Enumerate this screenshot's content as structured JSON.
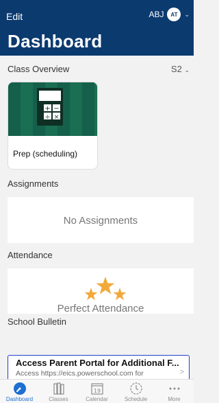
{
  "header": {
    "edit_label": "Edit",
    "user_initials": "ABJ",
    "avatar_text": "AT",
    "title": "Dashboard"
  },
  "class_overview": {
    "label": "Class Overview",
    "term": "S2",
    "classes": [
      {
        "name": "Prep (scheduling)"
      }
    ]
  },
  "assignments": {
    "label": "Assignments",
    "empty_text": "No Assignments"
  },
  "attendance": {
    "label": "Attendance",
    "status_text": "Perfect Attendance"
  },
  "bulletin": {
    "label": "School Bulletin",
    "title": "Access Parent Portal for Additional F...",
    "body": "Access https://eics.powerschool.com for additional features, such as the ability to su..."
  },
  "tabs": [
    {
      "label": "Dashboard",
      "icon": "dashboard-icon",
      "active": true
    },
    {
      "label": "Classes",
      "icon": "classes-icon",
      "active": false
    },
    {
      "label": "Calendar",
      "icon": "calendar-icon",
      "date": "19",
      "active": false
    },
    {
      "label": "Schedule",
      "icon": "schedule-icon",
      "active": false
    },
    {
      "label": "More",
      "icon": "more-icon",
      "active": false
    }
  ],
  "colors": {
    "header_bg": "#0b3a6e",
    "accent": "#1d6fd1",
    "star": "#f2a93b",
    "class_card": "#1a6e52"
  }
}
